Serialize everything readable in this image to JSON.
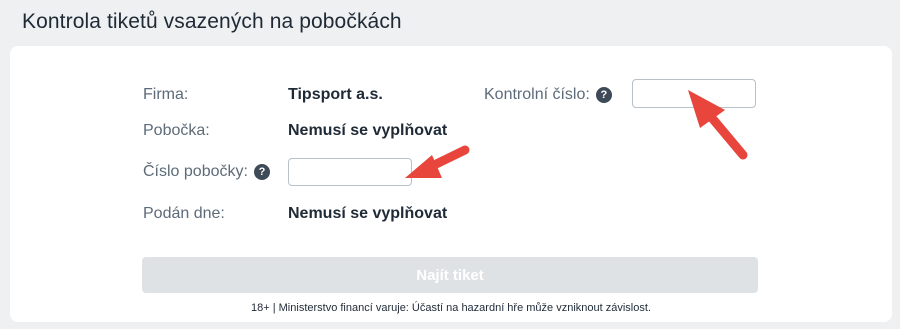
{
  "page": {
    "title": "Kontrola tiketů vsazených na pobočkách"
  },
  "form": {
    "firma_label": "Firma:",
    "firma_value": "Tipsport a.s.",
    "pobocka_label": "Pobočka:",
    "pobocka_value": "Nemusí se vyplňovat",
    "cislo_pobocky_label": "Číslo pobočky:",
    "cislo_pobocky_value": "",
    "podan_dne_label": "Podán dne:",
    "podan_dne_value": "Nemusí se vyplňovat",
    "kontrolni_cislo_label": "Kontrolní číslo:",
    "kontrolni_cislo_value": "",
    "help_glyph": "?"
  },
  "actions": {
    "submit_label": "Najít tiket"
  },
  "footer": {
    "disclaimer": "18+ | Ministerstvo financí varuje: Účastí na hazardní hře může vzniknout závislost."
  },
  "colors": {
    "annotation_arrow": "#e8453c",
    "button_disabled": "#dfe2e5"
  }
}
